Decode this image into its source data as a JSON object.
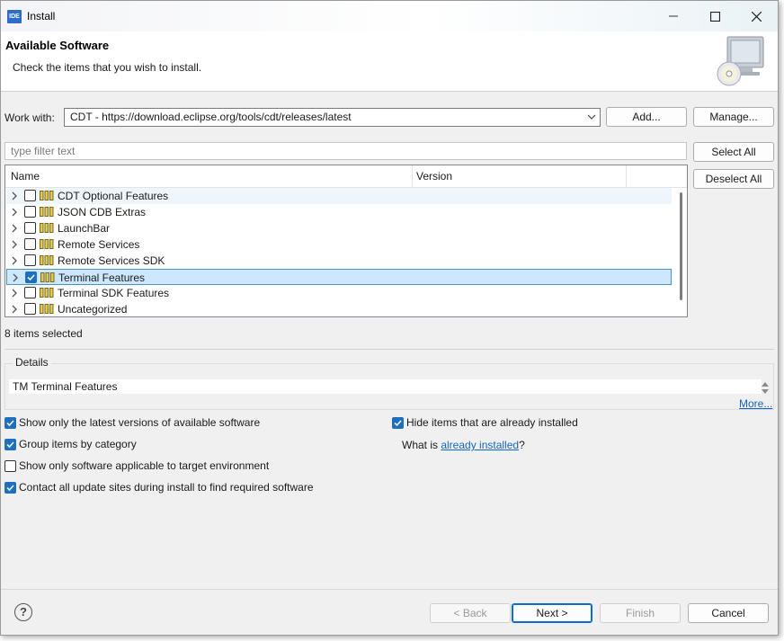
{
  "window": {
    "app_icon": "IDE",
    "title": "Install"
  },
  "header": {
    "title": "Available Software",
    "subtitle": "Check the items that you wish to install.",
    "image_icon": "install-monitor-cd-icon"
  },
  "work_with": {
    "label": "Work with:",
    "value": "CDT - https://download.eclipse.org/tools/cdt/releases/latest",
    "add_label": "Add...",
    "manage_label": "Manage..."
  },
  "filter": {
    "placeholder": "type filter text",
    "select_all_label": "Select All",
    "deselect_all_label": "Deselect All"
  },
  "table": {
    "columns": [
      "Name",
      "Version"
    ],
    "rows": [
      {
        "label": "CDT Optional Features",
        "checked": false,
        "selected": false
      },
      {
        "label": "JSON CDB Extras",
        "checked": false,
        "selected": false
      },
      {
        "label": "LaunchBar",
        "checked": false,
        "selected": false
      },
      {
        "label": "Remote Services",
        "checked": false,
        "selected": false
      },
      {
        "label": "Remote Services SDK",
        "checked": false,
        "selected": false
      },
      {
        "label": "Terminal Features",
        "checked": true,
        "selected": true
      },
      {
        "label": "Terminal SDK Features",
        "checked": false,
        "selected": false
      },
      {
        "label": "Uncategorized",
        "checked": false,
        "selected": false
      }
    ]
  },
  "status": {
    "selected_count": "8 items selected"
  },
  "details": {
    "title": "Details",
    "text": "TM Terminal Features",
    "more_link": "More..."
  },
  "options": {
    "latest_versions": {
      "label": "Show only the latest versions of available software",
      "checked": true
    },
    "group_by_category": {
      "label": "Group items by category",
      "checked": true
    },
    "target_env": {
      "label": "Show only software applicable to target environment",
      "checked": false
    },
    "contact_sites": {
      "label": "Contact all update sites during install to find required software",
      "checked": true
    },
    "hide_installed": {
      "label": "Hide items that are already installed",
      "checked": true
    },
    "what_is_prefix": "What is ",
    "already_installed_link": "already installed",
    "what_is_suffix": "?"
  },
  "footer": {
    "help_symbol": "?",
    "back_label": "< Back",
    "next_label": "Next >",
    "finish_label": "Finish",
    "cancel_label": "Cancel"
  },
  "colors": {
    "accent": "#1f6fbf",
    "selection_bg": "#cce8ff",
    "link": "#1466c0"
  }
}
